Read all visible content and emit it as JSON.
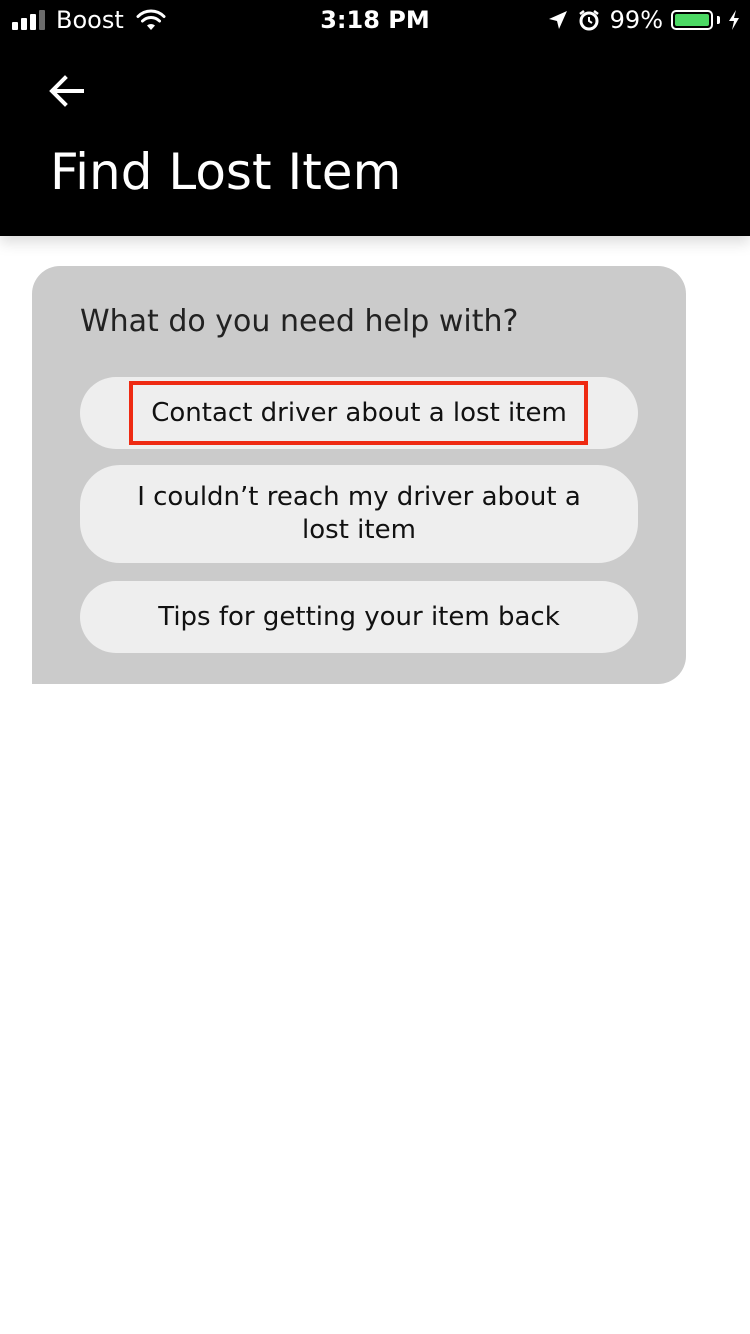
{
  "status_bar": {
    "carrier": "Boost",
    "time": "3:18 PM",
    "battery_percent": "99%",
    "signal_bars_filled": 3,
    "signal_bars_total": 4,
    "battery_level": 0.99,
    "battery_color": "#4cd964",
    "icons": [
      "signal-icon",
      "wifi-icon",
      "location-arrow-icon",
      "alarm-clock-icon",
      "battery-icon",
      "charging-bolt-icon"
    ]
  },
  "header": {
    "title": "Find Lost Item",
    "back_icon": "arrow-left-icon",
    "background": "#000000"
  },
  "help_card": {
    "question": "What do you need help with?",
    "options": [
      {
        "label": "Contact driver about a lost item",
        "highlighted": true
      },
      {
        "label": "I couldn’t reach my driver about a lost item",
        "highlighted": false
      },
      {
        "label": "Tips for getting your item back",
        "highlighted": false
      }
    ],
    "highlight_color": "#ee2a12"
  }
}
